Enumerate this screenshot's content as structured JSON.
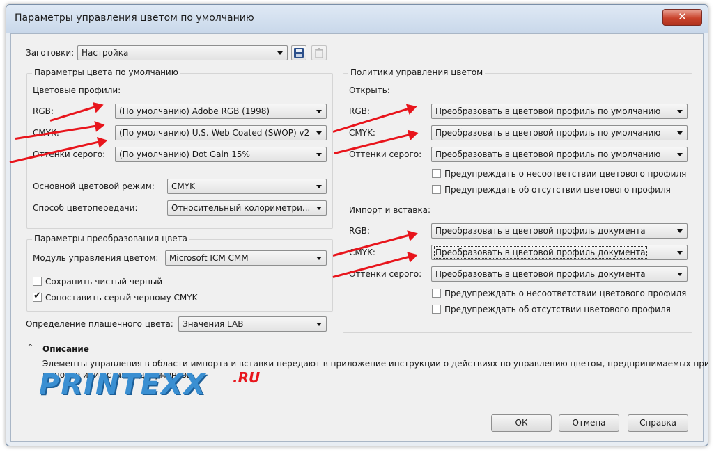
{
  "window": {
    "title": "Параметры управления цветом по умолчанию",
    "close": "✕"
  },
  "presets": {
    "label": "Заготовки:",
    "value": "Настройка"
  },
  "default_color": {
    "group_title": "Параметры цвета по умолчанию",
    "profiles_label": "Цветовые профили:",
    "rgb_label": "RGB:",
    "rgb_value": "(По умолчанию) Adobe RGB (1998)",
    "cmyk_label": "CMYK:",
    "cmyk_value": "(По умолчанию) U.S. Web Coated (SWOP) v2",
    "gray_label": "Оттенки серого:",
    "gray_value": "(По умолчанию) Dot Gain 15%",
    "mode_label": "Основной цветовой режим:",
    "mode_value": "CMYK",
    "intent_label": "Способ цветопередачи:",
    "intent_value": "Относительный колориметри..."
  },
  "conversion": {
    "group_title": "Параметры преобразования цвета",
    "engine_label": "Модуль управления цветом:",
    "engine_value": "Microsoft ICM CMM",
    "keep_black_label": "Сохранить чистый черный",
    "keep_black_checked": false,
    "map_gray_label": "Сопоставить серый черному CMYK",
    "map_gray_checked": true
  },
  "spot": {
    "label": "Определение плашечного цвета:",
    "value": "Значения LAB"
  },
  "policies": {
    "group_title": "Политики управления цветом",
    "open": {
      "title": "Открыть:",
      "rgb_label": "RGB:",
      "rgb_value": "Преобразовать в цветовой профиль по умолчанию",
      "cmyk_label": "CMYK:",
      "cmyk_value": "Преобразовать в цветовой профиль по умолчанию",
      "gray_label": "Оттенки серого:",
      "gray_value": "Преобразовать в цветовой профиль по умолчанию",
      "warn_mismatch": "Предупреждать о несоответствии цветового профиля",
      "warn_missing": "Предупреждать об отсутствии цветового профиля"
    },
    "import": {
      "title": "Импорт и вставка:",
      "rgb_label": "RGB:",
      "rgb_value": "Преобразовать в цветовой профиль документа",
      "cmyk_label": "CMYK:",
      "cmyk_value": "Преобразовать в цветовой профиль документа",
      "gray_label": "Оттенки серого:",
      "gray_value": "Преобразовать в цветовой профиль документа",
      "warn_mismatch": "Предупреждать о несоответствии цветового профиля",
      "warn_missing": "Предупреждать об отсутствии цветового профиля"
    }
  },
  "description": {
    "title": "Описание",
    "line1": "Элементы управления в области импорта и вставки передают в приложение инструкции о действиях по управлению цветом, предпринимаемых при",
    "line2": "импорте или вставке документов."
  },
  "watermark": {
    "main": "PRINTEXX",
    "suffix": ".RU"
  },
  "buttons": {
    "ok": "ОК",
    "cancel": "Отмена",
    "help": "Справка"
  },
  "colors": {
    "arrow": "#e8151c",
    "logo": "#3a8fd2",
    "close": "#c9432c"
  }
}
